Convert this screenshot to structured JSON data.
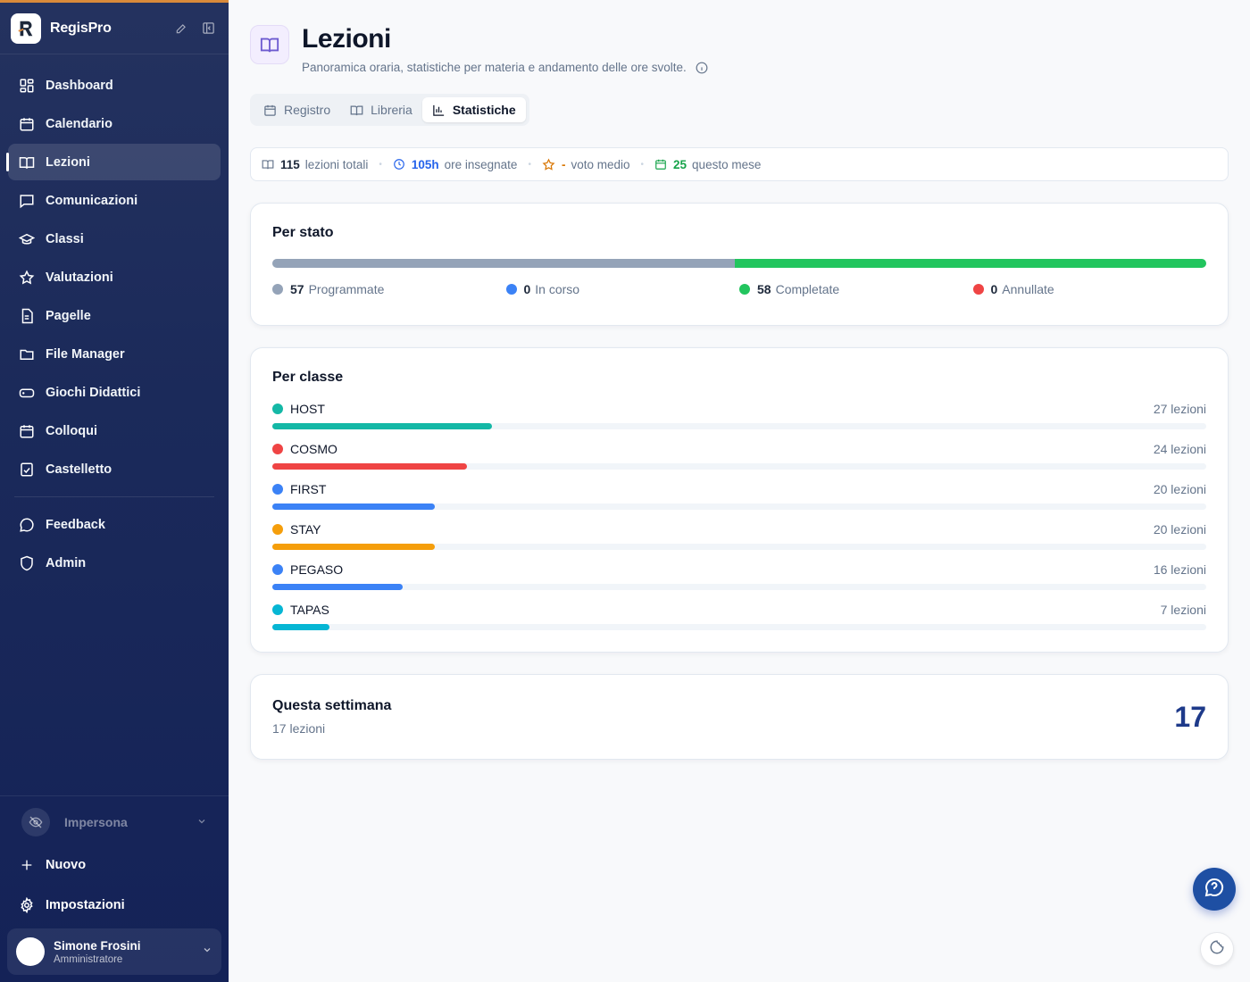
{
  "app": {
    "name": "RegisPro"
  },
  "sidebar": {
    "items": [
      {
        "label": "Dashboard",
        "icon": "dashboard-icon"
      },
      {
        "label": "Calendario",
        "icon": "calendar-icon"
      },
      {
        "label": "Lezioni",
        "icon": "book-open-icon",
        "active": true
      },
      {
        "label": "Comunicazioni",
        "icon": "message-icon"
      },
      {
        "label": "Classi",
        "icon": "graduation-cap-icon"
      },
      {
        "label": "Valutazioni",
        "icon": "star-icon"
      },
      {
        "label": "Pagelle",
        "icon": "report-icon"
      },
      {
        "label": "File Manager",
        "icon": "folder-icon"
      },
      {
        "label": "Giochi Didattici",
        "icon": "gamepad-icon"
      },
      {
        "label": "Colloqui",
        "icon": "calendar-icon"
      },
      {
        "label": "Castelletto",
        "icon": "clipboard-check-icon"
      }
    ],
    "secondary": [
      {
        "label": "Feedback",
        "icon": "chat-icon"
      },
      {
        "label": "Admin",
        "icon": "shield-icon"
      }
    ],
    "impersona_label": "Impersona",
    "new_label": "Nuovo",
    "settings_label": "Impostazioni",
    "user": {
      "name": "Simone Frosini",
      "role": "Amministratore"
    }
  },
  "page": {
    "title": "Lezioni",
    "subtitle": "Panoramica oraria, statistiche per materia e andamento delle ore svolte."
  },
  "tabs": [
    {
      "label": "Registro",
      "icon": "calendar-icon"
    },
    {
      "label": "Libreria",
      "icon": "book-open-icon"
    },
    {
      "label": "Statistiche",
      "icon": "bar-chart-icon",
      "active": true
    }
  ],
  "summary": {
    "total_value": "115",
    "total_label": "lezioni totali",
    "hours_value": "105h",
    "hours_label": "ore insegnate",
    "vote_value": "-",
    "vote_label": "voto medio",
    "month_value": "25",
    "month_label": "questo mese"
  },
  "status_card": {
    "title": "Per stato",
    "items": [
      {
        "count": "57",
        "label": "Programmate",
        "value": 57,
        "color": "#94a3b8"
      },
      {
        "count": "0",
        "label": "In corso",
        "value": 0,
        "color": "#3b82f6"
      },
      {
        "count": "58",
        "label": "Completate",
        "value": 58,
        "color": "#22c55e"
      },
      {
        "count": "0",
        "label": "Annullate",
        "value": 0,
        "color": "#ef4444"
      }
    ]
  },
  "class_card": {
    "title": "Per classe",
    "max": 115,
    "rows": [
      {
        "name": "HOST",
        "count_label": "27 lezioni",
        "value": 27,
        "color": "#14b8a6"
      },
      {
        "name": "COSMO",
        "count_label": "24 lezioni",
        "value": 24,
        "color": "#ef4444"
      },
      {
        "name": "FIRST",
        "count_label": "20 lezioni",
        "value": 20,
        "color": "#3b82f6"
      },
      {
        "name": "STAY",
        "count_label": "20 lezioni",
        "value": 20,
        "color": "#f59e0b"
      },
      {
        "name": "PEGASO",
        "count_label": "16 lezioni",
        "value": 16,
        "color": "#3b82f6"
      },
      {
        "name": "TAPAS",
        "count_label": "7 lezioni",
        "value": 7,
        "color": "#06b6d4"
      }
    ]
  },
  "week_card": {
    "title": "Questa settimana",
    "subtitle": "17 lezioni",
    "number": "17"
  }
}
